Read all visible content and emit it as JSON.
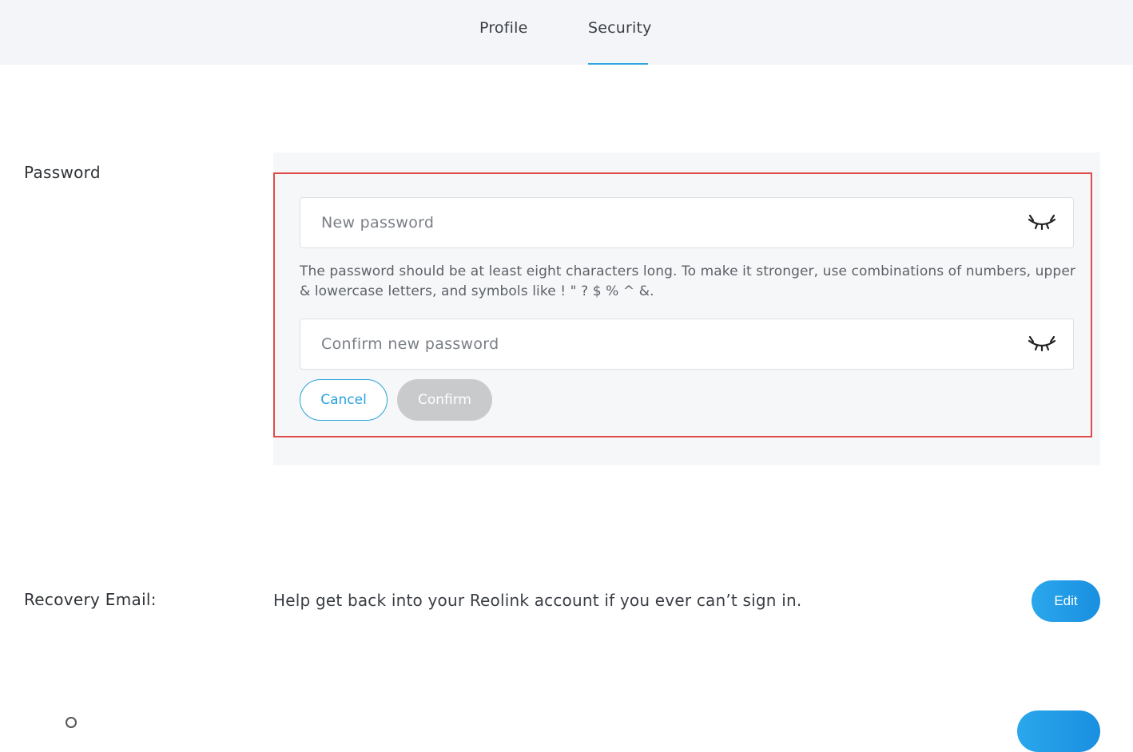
{
  "tabs": {
    "profile": "Profile",
    "security": "Security"
  },
  "password_section": {
    "label": "Password",
    "new_password_placeholder": "New password",
    "new_password_value": "",
    "confirm_password_placeholder": "Confirm new password",
    "confirm_password_value": "",
    "hint": "The password should be at least eight characters long. To make it stronger, use combinations of numbers, upper & lowercase letters, and symbols like ! \" ? $ % ^ &.",
    "cancel_label": "Cancel",
    "confirm_label": "Confirm",
    "toggle_icon": "eye-closed-icon"
  },
  "recovery_section": {
    "label": "Recovery Email:",
    "description": "Help get back into your Reolink account if you ever can’t sign in.",
    "edit_label": "Edit"
  },
  "colors": {
    "accent": "#2aa2dd",
    "highlight_border": "#e04a4a",
    "disabled_button": "#c9cacc"
  }
}
